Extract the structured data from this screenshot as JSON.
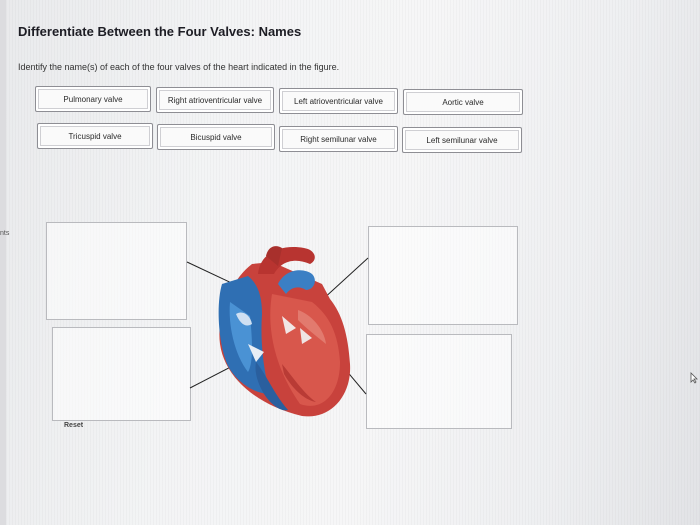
{
  "title": "Differentiate Between the Four Valves: Names",
  "instruction": "Identify the name(s) of each of the four valves of the heart indicated in the figure.",
  "labels": [
    "Pulmonary valve",
    "Right atrioventricular valve",
    "Left atrioventricular valve",
    "Aortic valve",
    "Tricuspid valve",
    "Bicuspid valve",
    "Right semilunar valve",
    "Left semilunar valve"
  ],
  "reset_label": "Reset",
  "edge_text": "nts",
  "icons": {
    "heart": "heart-diagram-icon",
    "cursor": "mouse-cursor-icon"
  }
}
